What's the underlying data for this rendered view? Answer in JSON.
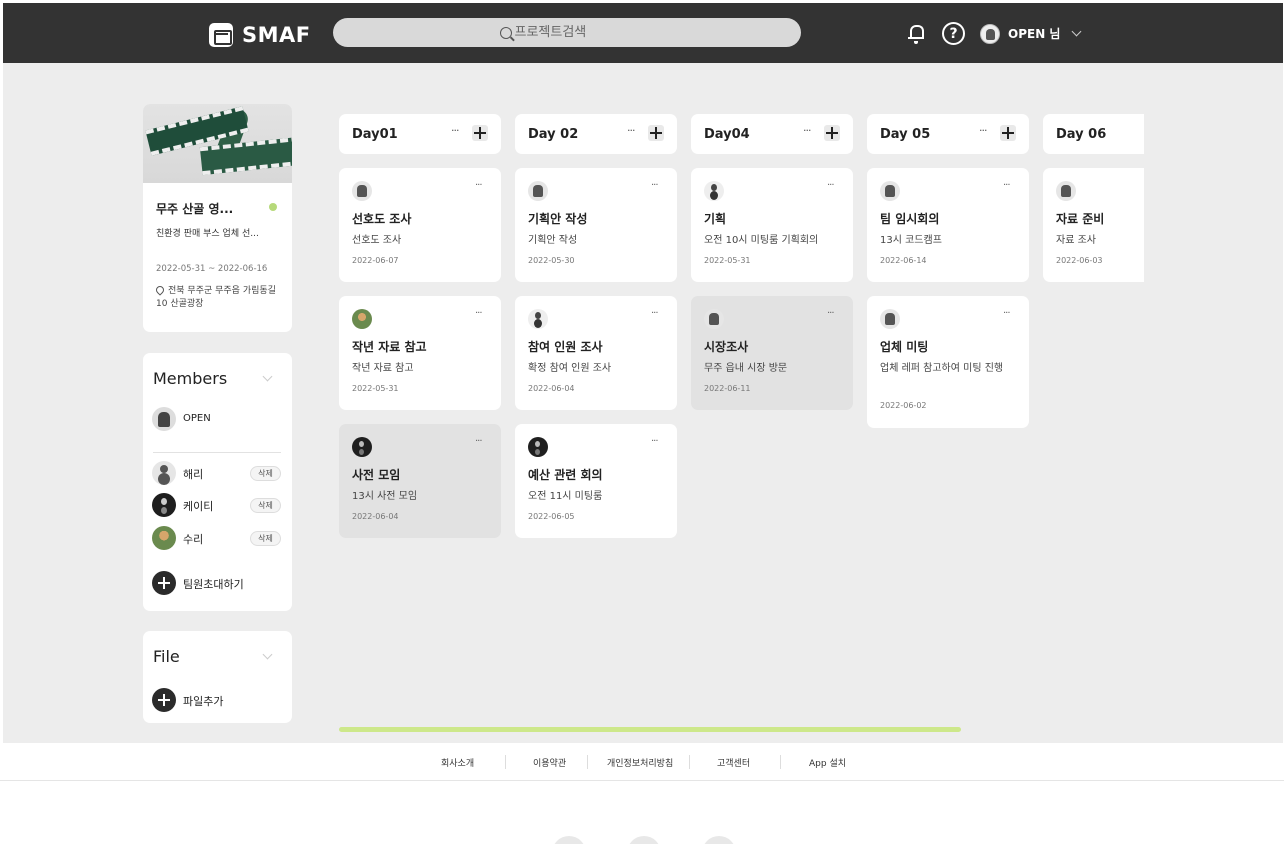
{
  "header": {
    "brand": "SMAF",
    "search_placeholder": "프로젝트검색",
    "user_name": "OPEN 님"
  },
  "project": {
    "title": "무주 산골 영...",
    "subtitle": "친환경 판매 부스 업체 선...",
    "date_range": "2022-05-31 ~ 2022-06-16",
    "address": "전북 무주군 무주읍 가림동길 10 산골광장"
  },
  "members": {
    "title": "Members",
    "owner": "OPEN",
    "list": [
      {
        "name": "해리",
        "action": "삭제"
      },
      {
        "name": "케이티",
        "action": "삭제"
      },
      {
        "name": "수리",
        "action": "삭제"
      }
    ],
    "invite_label": "팀원초대하기"
  },
  "files": {
    "title": "File",
    "add_label": "파일추가"
  },
  "columns": [
    {
      "title": "Day01",
      "more": "···"
    },
    {
      "title": "Day 02",
      "more": "···"
    },
    {
      "title": "Day04",
      "more": "···"
    },
    {
      "title": "Day 05",
      "more": "···"
    },
    {
      "title": "Day 06"
    }
  ],
  "tasks": [
    [
      {
        "title": "선호도 조사",
        "desc": "선호도 조사",
        "date": "2022-06-07"
      },
      {
        "title": "작년 자료 참고",
        "desc": "작년 자료 참고",
        "date": "2022-05-31"
      },
      {
        "title": "사전 모임",
        "desc": "13시 사전 모임",
        "date": "2022-06-04"
      }
    ],
    [
      {
        "title": "기획안 작성",
        "desc": "기획안 작성",
        "date": "2022-05-30"
      },
      {
        "title": "참여 인원 조사",
        "desc": "확정 참여 인원 조사",
        "date": "2022-06-04"
      },
      {
        "title": "예산 관련 회의",
        "desc": "오전 11시 미팅룸",
        "date": "2022-06-05"
      }
    ],
    [
      {
        "title": "기획",
        "desc": "오전 10시 미팅룸 기획회의",
        "date": "2022-05-31"
      },
      {
        "title": "시장조사",
        "desc": "무주 읍내 시장 방문",
        "date": "2022-06-11"
      }
    ],
    [
      {
        "title": "팀 임시회의",
        "desc": "13시 코드캠프",
        "date": "2022-06-14"
      },
      {
        "title": "업체 미팅",
        "desc": "업체 레퍼 참고하여 미팅 진행",
        "date": "2022-06-02"
      }
    ],
    [
      {
        "title": "자료 준비",
        "desc": "자료 조사",
        "date": "2022-06-03"
      }
    ]
  ],
  "footer": {
    "links": [
      "회사소개",
      "이용약관",
      "개인정보처리방침",
      "고객센터",
      "App 설치"
    ]
  }
}
